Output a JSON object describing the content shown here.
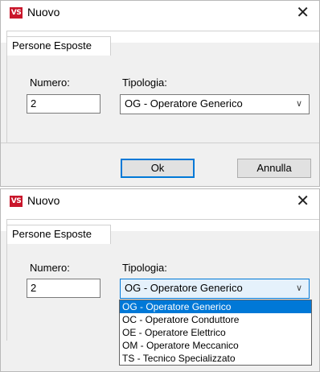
{
  "dialogs": [
    {
      "title": "Nuovo",
      "logo_text": "VS",
      "close_glyph": "✕",
      "tab": "Persone Esposte",
      "numero_label": "Numero:",
      "numero_value": "2",
      "tipologia_label": "Tipologia:",
      "tipologia_value": "OG - Operatore Generico",
      "ok_label": "Ok",
      "annulla_label": "Annulla"
    },
    {
      "title": "Nuovo",
      "logo_text": "VS",
      "close_glyph": "✕",
      "tab": "Persone Esposte",
      "numero_label": "Numero:",
      "numero_value": "2",
      "tipologia_label": "Tipologia:",
      "tipologia_value": "OG - Operatore Generico",
      "dropdown_open": true
    }
  ],
  "tipologia_options": [
    "OG - Operatore Generico",
    "OC - Operatore Conduttore",
    "OE - Operatore Elettrico",
    "OM - Operatore Meccanico",
    "TS - Tecnico Specializzato"
  ],
  "selected_option_index": 0,
  "background_peek_text": "... ...",
  "colors": {
    "accent": "#0078d7",
    "logo": "#c9162b",
    "dialog_bg": "#f0f0f0"
  },
  "icons": {
    "close": "close-icon",
    "combo": "chevron-down-icon",
    "app": "app-logo-icon"
  }
}
